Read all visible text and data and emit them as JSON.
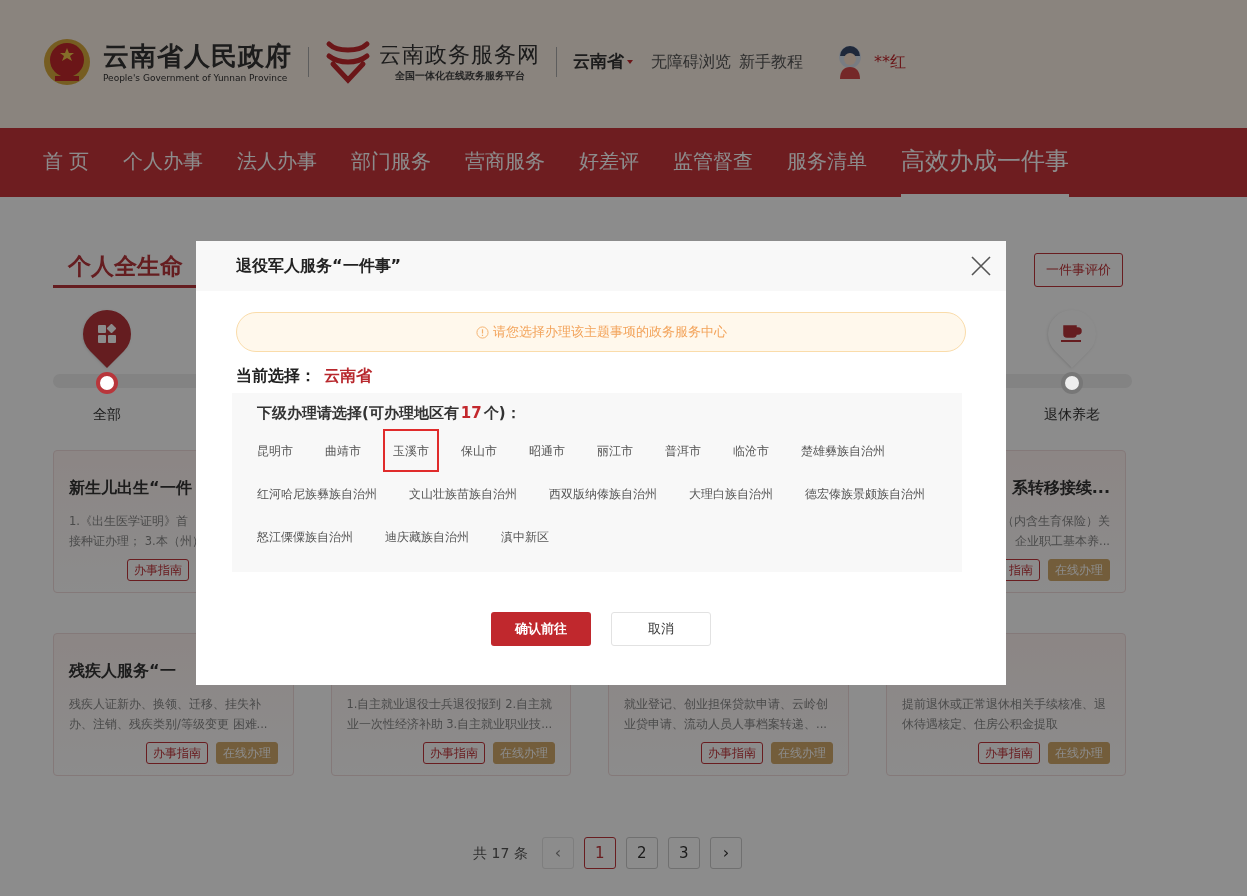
{
  "header": {
    "gov_title": "云南省人民政府",
    "gov_subtitle": "People's Government of Yunnan Province",
    "portal_title": "云南政务服务网",
    "portal_subtitle": "全国一体化在线政务服务平台",
    "region": "云南省",
    "links": [
      "无障碍浏览",
      "新手教程"
    ],
    "user": "**红"
  },
  "nav": [
    {
      "label": "首 页",
      "selected": false
    },
    {
      "label": "个人办事",
      "selected": false
    },
    {
      "label": "法人办事",
      "selected": false
    },
    {
      "label": "部门服务",
      "selected": false
    },
    {
      "label": "营商服务",
      "selected": false
    },
    {
      "label": "好差评",
      "selected": false
    },
    {
      "label": "监管督查",
      "selected": false
    },
    {
      "label": "服务清单",
      "selected": false
    },
    {
      "label": "高效办成一件事",
      "selected": true
    }
  ],
  "section": {
    "title": "个人全生命",
    "rate_button": "一件事评价"
  },
  "stages": [
    {
      "label": "全部",
      "selected": true,
      "kind": "all"
    },
    {
      "label": "退休养老",
      "selected": false,
      "kind": "retire"
    }
  ],
  "first_row": {
    "left_card": {
      "title": "新生儿出生“一件",
      "desc": [
        "1.《出生医学证明》首",
        "接种证办理； 3.本（州）"
      ],
      "buttons": [
        {
          "label": "办事指南",
          "kind": "guide"
        }
      ]
    },
    "right_card": {
      "title": "系转移接续...",
      "desc": [
        "（内含生育保险）关",
        "企业职工基本养..."
      ],
      "buttons": [
        {
          "label": "指南",
          "kind": "guide"
        },
        {
          "label": "在线办理",
          "kind": "online"
        }
      ]
    }
  },
  "second_row": [
    {
      "title": "残疾人服务“一",
      "desc": [
        "残疾人证新办、换领、迁移、挂失补",
        "办、注销、残疾类别/等级变更 困难..."
      ],
      "buttons": [
        {
          "label": "办事指南",
          "kind": "guide"
        },
        {
          "label": "在线办理",
          "kind": "online"
        }
      ]
    },
    {
      "desc": [
        "1.自主就业退役士兵退役报到 2.自主就",
        "业一次性经济补助 3.自主就业职业技..."
      ],
      "buttons": [
        {
          "label": "办事指南",
          "kind": "guide"
        },
        {
          "label": "在线办理",
          "kind": "online"
        }
      ]
    },
    {
      "desc": [
        "就业登记、创业担保贷款申请、云岭创",
        "业贷申请、流动人员人事档案转递、..."
      ],
      "buttons": [
        {
          "label": "办事指南",
          "kind": "guide"
        },
        {
          "label": "在线办理",
          "kind": "online"
        }
      ]
    },
    {
      "desc": [
        "提前退休或正常退休相关手续核准、退",
        "休待遇核定、住房公积金提取"
      ],
      "buttons": [
        {
          "label": "办事指南",
          "kind": "guide"
        },
        {
          "label": "在线办理",
          "kind": "online"
        }
      ]
    }
  ],
  "pagination": {
    "total": "共 17 条",
    "prev": {
      "label": "‹",
      "disabled": true
    },
    "pages": [
      {
        "label": "1",
        "selected": true
      },
      {
        "label": "2",
        "selected": false
      },
      {
        "label": "3",
        "selected": false
      }
    ],
    "next": {
      "label": "›",
      "disabled": false
    }
  },
  "modal": {
    "title": "退役军人服务“一件事”",
    "notice": "请您选择办理该主题事项的政务服务中心",
    "current_label": "当前选择：",
    "current_value": "云南省",
    "sub_heading_prefix": "下级办理请选择(可办理地区有",
    "count": "17",
    "sub_heading_suffix": "个)：",
    "regions": [
      {
        "label": "昆明市",
        "selected": false
      },
      {
        "label": "曲靖市",
        "selected": false
      },
      {
        "label": "玉溪市",
        "selected": true
      },
      {
        "label": "保山市",
        "selected": false
      },
      {
        "label": "昭通市",
        "selected": false
      },
      {
        "label": "丽江市",
        "selected": false
      },
      {
        "label": "普洱市",
        "selected": false
      },
      {
        "label": "临沧市",
        "selected": false
      },
      {
        "label": "楚雄彝族自治州",
        "selected": false
      },
      {
        "label": "红河哈尼族彝族自治州",
        "selected": false
      },
      {
        "label": "文山壮族苗族自治州",
        "selected": false
      },
      {
        "label": "西双版纳傣族自治州",
        "selected": false
      },
      {
        "label": "大理白族自治州",
        "selected": false
      },
      {
        "label": "德宏傣族景颇族自治州",
        "selected": false
      },
      {
        "label": "怒江傈僳族自治州",
        "selected": false
      },
      {
        "label": "迪庆藏族自治州",
        "selected": false
      },
      {
        "label": "滇中新区",
        "selected": false
      }
    ],
    "buttons": [
      {
        "label": "确认前往",
        "kind": "primary"
      },
      {
        "label": "取消",
        "kind": "secondary"
      }
    ]
  }
}
